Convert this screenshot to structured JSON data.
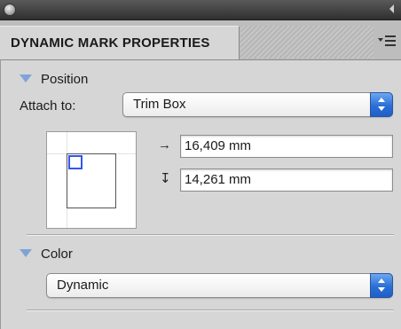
{
  "panel": {
    "tab_title": "DYNAMIC MARK PROPERTIES"
  },
  "position_section": {
    "header": "Position",
    "attach_label": "Attach to:",
    "attach_value": "Trim Box",
    "horizontal_offset": "16,409 mm",
    "vertical_offset": "14,261 mm",
    "horizontal_icon": "→",
    "vertical_icon": "↧"
  },
  "color_section": {
    "header": "Color",
    "color_value": "Dynamic"
  },
  "colors": {
    "accent_blue": "#2a6fd6",
    "disclosure": "#7fa3d8",
    "mark_outline": "#3355ee"
  }
}
